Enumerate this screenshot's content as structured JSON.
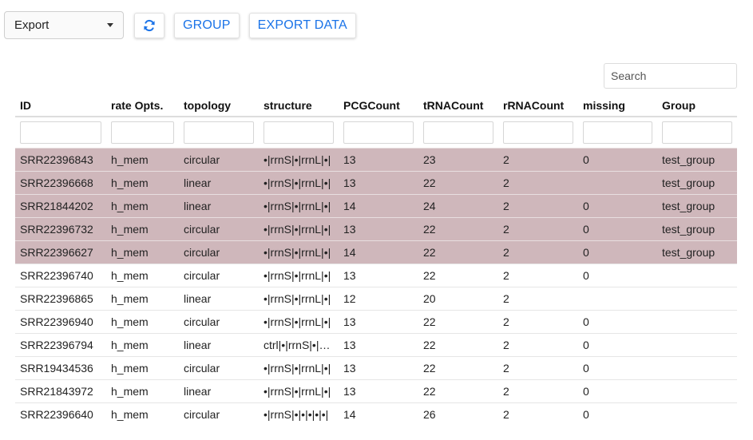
{
  "toolbar": {
    "export_select_value": "Export",
    "refresh_icon": "refresh-icon",
    "group_label": "GROUP",
    "export_data_label": "EXPORT DATA"
  },
  "search": {
    "placeholder": "Search"
  },
  "colors": {
    "accent": "#1a73e8",
    "selected_row": "#cfb7bb"
  },
  "table": {
    "headers": [
      "ID",
      "rate Opts.",
      "topology",
      "structure",
      "PCGCount",
      "tRNACount",
      "rRNACount",
      "missing",
      "Group"
    ],
    "rows": [
      {
        "selected": true,
        "cells": [
          "SRR22396843",
          "h_mem",
          "circular",
          "•|rrnS|•|rrnL|•|",
          "13",
          "23",
          "2",
          "0",
          "test_group"
        ]
      },
      {
        "selected": true,
        "cells": [
          "SRR22396668",
          "h_mem",
          "linear",
          "•|rrnS|•|rrnL|•|",
          "13",
          "22",
          "2",
          "",
          "test_group"
        ]
      },
      {
        "selected": true,
        "cells": [
          "SRR21844202",
          "h_mem",
          "linear",
          "•|rrnS|•|rrnL|•|",
          "14",
          "24",
          "2",
          "0",
          "test_group"
        ]
      },
      {
        "selected": true,
        "cells": [
          "SRR22396732",
          "h_mem",
          "circular",
          "•|rrnS|•|rrnL|•|",
          "13",
          "22",
          "2",
          "0",
          "test_group"
        ]
      },
      {
        "selected": true,
        "cells": [
          "SRR22396627",
          "h_mem",
          "circular",
          "•|rrnS|•|rrnL|•|",
          "14",
          "22",
          "2",
          "0",
          "test_group"
        ]
      },
      {
        "selected": false,
        "cells": [
          "SRR22396740",
          "h_mem",
          "circular",
          "•|rrnS|•|rrnL|•|",
          "13",
          "22",
          "2",
          "0",
          ""
        ]
      },
      {
        "selected": false,
        "cells": [
          "SRR22396865",
          "h_mem",
          "linear",
          "•|rrnS|•|rrnL|•|",
          "12",
          "20",
          "2",
          "",
          ""
        ]
      },
      {
        "selected": false,
        "cells": [
          "SRR22396940",
          "h_mem",
          "circular",
          "•|rrnS|•|rrnL|•|",
          "13",
          "22",
          "2",
          "0",
          ""
        ]
      },
      {
        "selected": false,
        "cells": [
          "SRR22396794",
          "h_mem",
          "linear",
          "ctrl|•|rrnS|•|rrnL|",
          "13",
          "22",
          "2",
          "0",
          ""
        ]
      },
      {
        "selected": false,
        "cells": [
          "SRR19434536",
          "h_mem",
          "circular",
          "•|rrnS|•|rrnL|•|",
          "13",
          "22",
          "2",
          "0",
          ""
        ]
      },
      {
        "selected": false,
        "cells": [
          "SRR21843972",
          "h_mem",
          "linear",
          "•|rrnS|•|rrnL|•|",
          "13",
          "22",
          "2",
          "0",
          ""
        ]
      },
      {
        "selected": false,
        "cells": [
          "SRR22396640",
          "h_mem",
          "circular",
          "•|rrnS|•|•|•|•|•|",
          "14",
          "26",
          "2",
          "0",
          ""
        ]
      }
    ]
  }
}
